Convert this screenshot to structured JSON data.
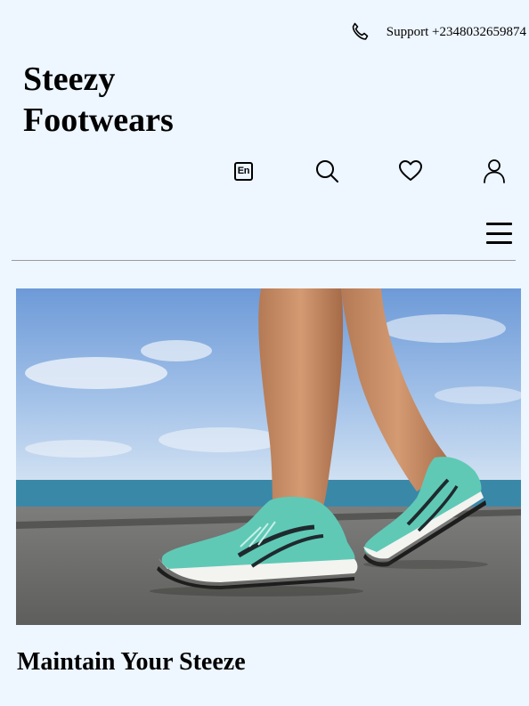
{
  "header": {
    "support_label": "Support +2348032659874",
    "brand_line1": "Steezy",
    "brand_line2": "Footwears",
    "language_code": "En"
  },
  "icons": {
    "phone": "phone-icon",
    "language": "language-icon",
    "search": "search-icon",
    "wishlist": "heart-icon",
    "account": "user-icon",
    "menu": "hamburger-menu-icon"
  },
  "hero": {
    "tagline": "Maintain Your Steeze"
  },
  "colors": {
    "background": "#eef6ff",
    "text": "#000000",
    "divider": "#9b9b9b",
    "shoe_accent": "#5fc9b6"
  }
}
